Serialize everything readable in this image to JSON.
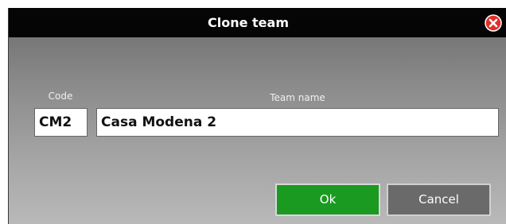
{
  "dialog": {
    "title": "Clone team",
    "close_icon": "close-circle-x-icon",
    "accent_close": "#e0302a",
    "titlebar_color": "#050505"
  },
  "form": {
    "code_label": "Code",
    "code_value": "CM2",
    "name_label": "Team name",
    "name_value": "Casa Modena 2"
  },
  "buttons": {
    "ok": {
      "mnemonic": "O",
      "rest": "k",
      "color": "#1a9a20"
    },
    "cancel": {
      "mnemonic": "C",
      "rest": "ancel",
      "color": "#6a6a6a"
    }
  }
}
